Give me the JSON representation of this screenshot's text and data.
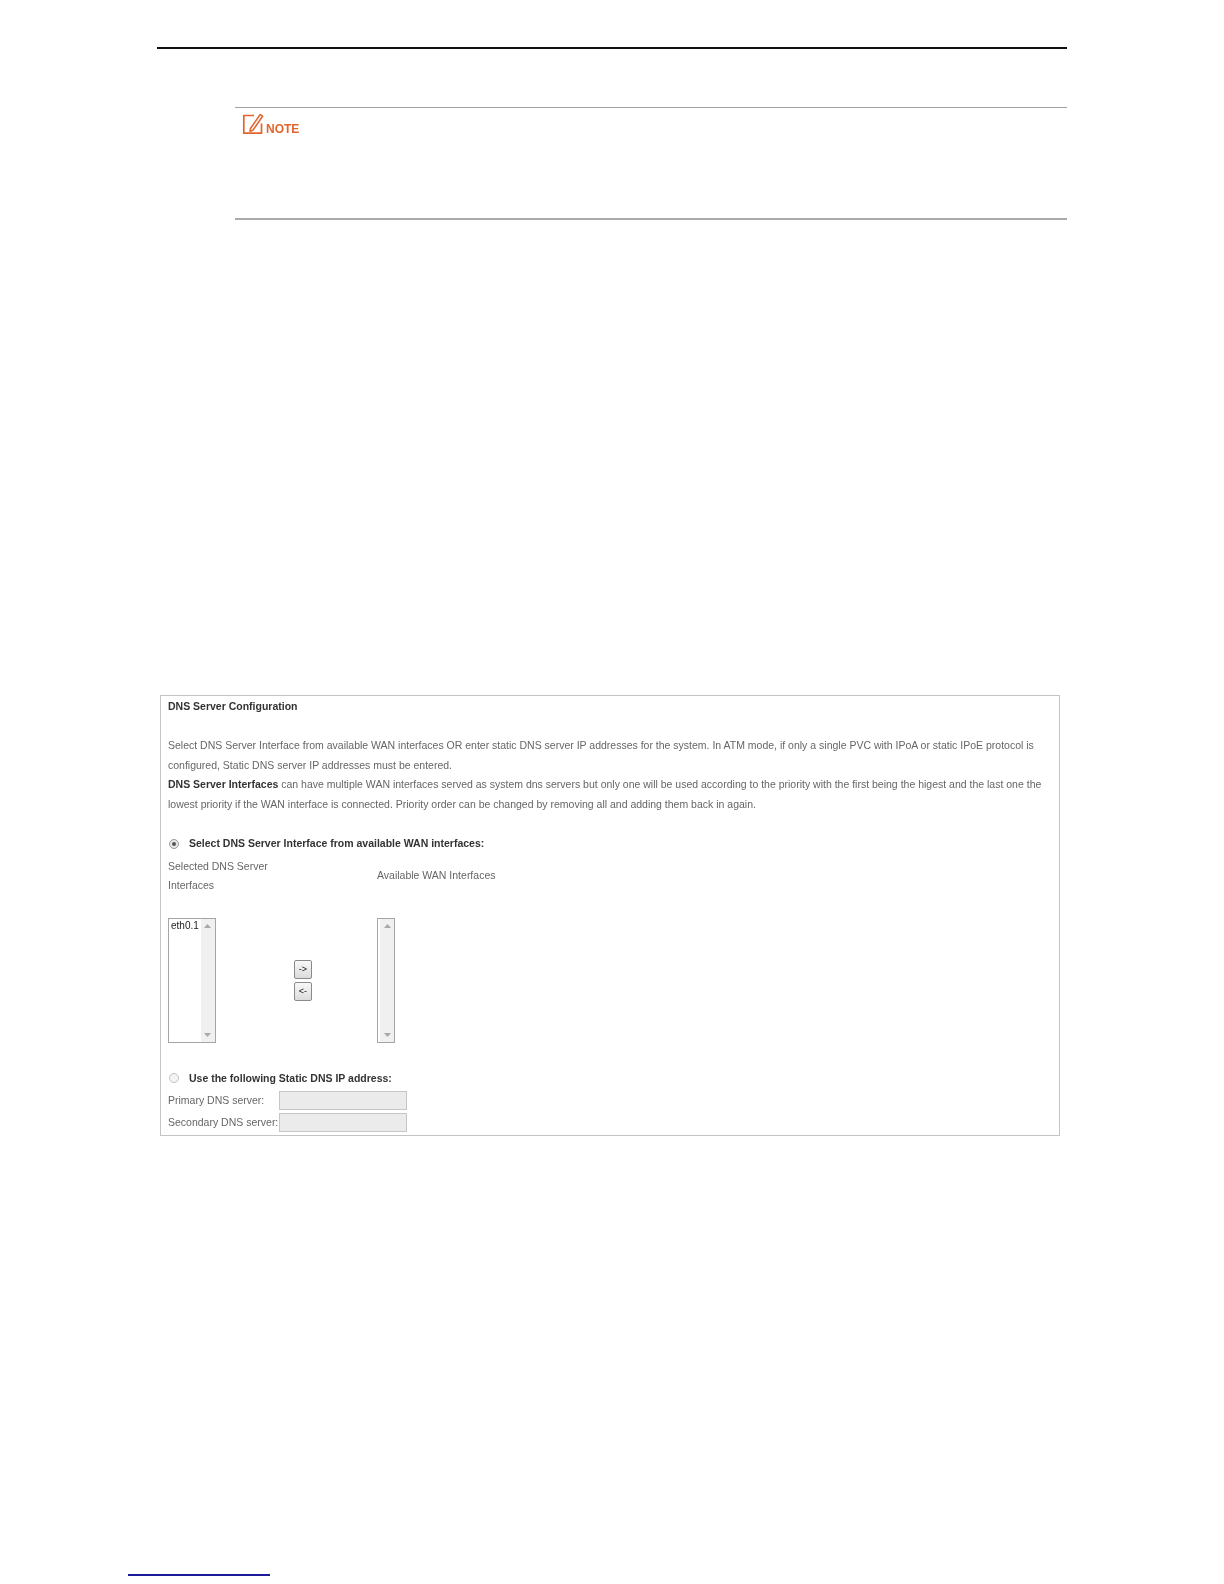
{
  "note": {
    "label": "NOTE"
  },
  "dns_config": {
    "title": "DNS Server Configuration",
    "paragraphs": [
      "Select DNS Server Interface from available WAN interfaces OR enter static DNS server IP addresses for the system. In ATM mode, if only a single PVC with IPoA or static IPoE protocol is configured, Static DNS server IP addresses must be entered.",
      "**DNS Server Interfaces** can have multiple WAN interfaces served as system dns servers but only one will be used according to the priority with the first being the higest and the last one the lowest priority if the WAN interface is connected. Priority order can be changed by removing all and adding them back in again."
    ],
    "interface_option": {
      "label": "Select DNS Server Interface from available WAN interfaces:",
      "selected": true
    },
    "selected_interfaces": {
      "heading": "Selected DNS Server Interfaces",
      "items": [
        {
          "label": "eth0.1",
          "selected": false
        }
      ]
    },
    "move_buttons": [
      "->",
      "<-"
    ],
    "available_interfaces": {
      "heading": "Available WAN Interfaces"
    },
    "static_option": {
      "label": "Use the following Static DNS IP address:",
      "selected": false
    },
    "dns_fields": [
      {
        "label": "Primary DNS server:",
        "disabled": true
      },
      {
        "label": "Secondary DNS server:",
        "disabled": true
      }
    ]
  }
}
